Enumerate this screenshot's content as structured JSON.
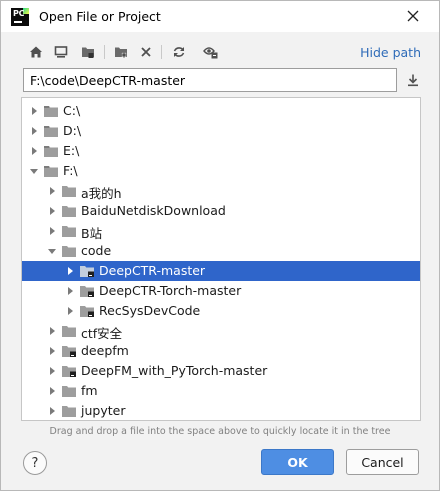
{
  "window": {
    "title": "Open File or Project"
  },
  "toolbar": {
    "buttons": [
      "home-icon",
      "desktop-icon",
      "project-folder-icon",
      "new-folder-icon",
      "delete-icon",
      "refresh-icon",
      "show-hidden-icon"
    ],
    "hide_path_label": "Hide path"
  },
  "path_field": {
    "value": "F:\\code\\DeepCTR-master"
  },
  "tree": {
    "rows": [
      {
        "label": "C:\\",
        "level": 0,
        "expanded": false,
        "icon": "drive-icon"
      },
      {
        "label": "D:\\",
        "level": 0,
        "expanded": false,
        "icon": "drive-icon"
      },
      {
        "label": "E:\\",
        "level": 0,
        "expanded": false,
        "icon": "drive-icon"
      },
      {
        "label": "F:\\",
        "level": 0,
        "expanded": true,
        "icon": "drive-icon"
      },
      {
        "label": "a我的h",
        "level": 1,
        "expanded": false,
        "icon": "folder-icon"
      },
      {
        "label": "BaiduNetdiskDownload",
        "level": 1,
        "expanded": false,
        "icon": "folder-icon"
      },
      {
        "label": "B站",
        "level": 1,
        "expanded": false,
        "icon": "folder-icon"
      },
      {
        "label": "code",
        "level": 1,
        "expanded": true,
        "icon": "folder-icon"
      },
      {
        "label": "DeepCTR-master",
        "level": 2,
        "expanded": false,
        "icon": "project-folder-icon",
        "selected": true
      },
      {
        "label": "DeepCTR-Torch-master",
        "level": 2,
        "expanded": false,
        "icon": "project-folder-icon"
      },
      {
        "label": "RecSysDevCode",
        "level": 2,
        "expanded": false,
        "icon": "project-folder-icon"
      },
      {
        "label": "ctf安全",
        "level": 1,
        "expanded": false,
        "icon": "folder-icon"
      },
      {
        "label": "deepfm",
        "level": 1,
        "expanded": false,
        "icon": "project-folder-icon"
      },
      {
        "label": "DeepFM_with_PyTorch-master",
        "level": 1,
        "expanded": false,
        "icon": "project-folder-icon"
      },
      {
        "label": "fm",
        "level": 1,
        "expanded": false,
        "icon": "folder-icon"
      },
      {
        "label": "jupyter",
        "level": 1,
        "expanded": false,
        "icon": "folder-icon"
      }
    ]
  },
  "hint": "Drag and drop a file into the space above to quickly locate it in the tree",
  "footer": {
    "help_label": "?",
    "ok_label": "OK",
    "cancel_label": "Cancel"
  },
  "colors": {
    "accent": "#2f65ca",
    "link": "#2e6bb8",
    "ok": "#4e8ee3"
  }
}
